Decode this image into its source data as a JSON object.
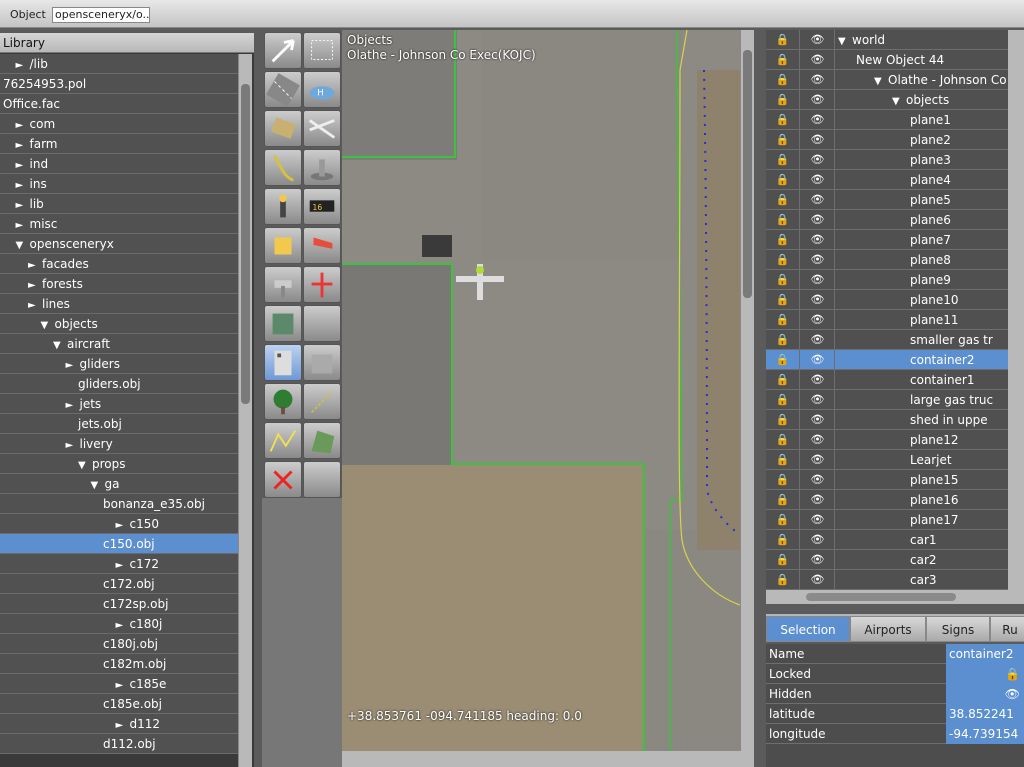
{
  "topbar": {
    "label": "Object",
    "field_value": "opensceneryx/o..."
  },
  "library": {
    "header": "Library",
    "rows": [
      {
        "text": "/lib",
        "tri": "►",
        "indent": 1
      },
      {
        "text": "76254953.pol",
        "tri": "",
        "indent": 0
      },
      {
        "text": "Office.fac",
        "tri": "",
        "indent": 0
      },
      {
        "text": "com",
        "tri": "►",
        "indent": 1
      },
      {
        "text": "farm",
        "tri": "►",
        "indent": 1
      },
      {
        "text": "ind",
        "tri": "►",
        "indent": 1
      },
      {
        "text": "ins",
        "tri": "►",
        "indent": 1
      },
      {
        "text": "lib",
        "tri": "►",
        "indent": 1
      },
      {
        "text": "misc",
        "tri": "►",
        "indent": 1
      },
      {
        "text": "opensceneryx",
        "tri": "▼",
        "indent": 1
      },
      {
        "text": "facades",
        "tri": "►",
        "indent": 2
      },
      {
        "text": "forests",
        "tri": "►",
        "indent": 2
      },
      {
        "text": "lines",
        "tri": "►",
        "indent": 2
      },
      {
        "text": "objects",
        "tri": "▼",
        "indent": 3
      },
      {
        "text": "aircraft",
        "tri": "▼",
        "indent": 4
      },
      {
        "text": "gliders",
        "tri": "►",
        "indent": 5
      },
      {
        "text": "gliders.obj",
        "tri": "",
        "indent": 6
      },
      {
        "text": "jets",
        "tri": "►",
        "indent": 5
      },
      {
        "text": "jets.obj",
        "tri": "",
        "indent": 6
      },
      {
        "text": "livery",
        "tri": "►",
        "indent": 5
      },
      {
        "text": "props",
        "tri": "▼",
        "indent": 6
      },
      {
        "text": "ga",
        "tri": "▼",
        "indent": 7
      },
      {
        "text": "bonanza_e35.obj",
        "tri": "",
        "indent": 8
      },
      {
        "text": "c150",
        "tri": "►",
        "indent": 9
      },
      {
        "text": "c150.obj",
        "tri": "",
        "indent": 8
      },
      {
        "text": "c172",
        "tri": "►",
        "indent": 9
      },
      {
        "text": "c172.obj",
        "tri": "",
        "indent": 8
      },
      {
        "text": "c172sp.obj",
        "tri": "",
        "indent": 8
      },
      {
        "text": "c180j",
        "tri": "►",
        "indent": 9
      },
      {
        "text": "c180j.obj",
        "tri": "",
        "indent": 8
      },
      {
        "text": "c182m.obj",
        "tri": "",
        "indent": 8
      },
      {
        "text": "c185e",
        "tri": "►",
        "indent": 9
      },
      {
        "text": "c185e.obj",
        "tri": "",
        "indent": 8
      },
      {
        "text": "d112",
        "tri": "►",
        "indent": 9
      },
      {
        "text": "d112.obj",
        "tri": "",
        "indent": 8
      }
    ],
    "selected_index": 24
  },
  "map": {
    "title_line1": "Objects",
    "title_line2": "Olathe - Johnson Co Exec(KOJC)",
    "coords": "+38.853761 -094.741185 heading: 0.0"
  },
  "hierarchy": {
    "rows": [
      {
        "text": "world",
        "tri": "▼",
        "indent": 1
      },
      {
        "text": "New Object 44",
        "tri": "",
        "indent": 2
      },
      {
        "text": "Olathe - Johnson Co",
        "tri": "▼",
        "indent": 3
      },
      {
        "text": "objects",
        "tri": "▼",
        "indent": 4
      },
      {
        "text": "plane1",
        "tri": "",
        "indent": 5
      },
      {
        "text": "plane2",
        "tri": "",
        "indent": 5
      },
      {
        "text": "plane3",
        "tri": "",
        "indent": 5
      },
      {
        "text": "plane4",
        "tri": "",
        "indent": 5
      },
      {
        "text": "plane5",
        "tri": "",
        "indent": 5
      },
      {
        "text": "plane6",
        "tri": "",
        "indent": 5
      },
      {
        "text": "plane7",
        "tri": "",
        "indent": 5
      },
      {
        "text": "plane8",
        "tri": "",
        "indent": 5
      },
      {
        "text": "plane9",
        "tri": "",
        "indent": 5
      },
      {
        "text": "plane10",
        "tri": "",
        "indent": 5
      },
      {
        "text": "plane11",
        "tri": "",
        "indent": 5
      },
      {
        "text": "smaller gas tr",
        "tri": "",
        "indent": 5
      },
      {
        "text": "container2",
        "tri": "",
        "indent": 5
      },
      {
        "text": "container1",
        "tri": "",
        "indent": 5
      },
      {
        "text": "large gas truc",
        "tri": "",
        "indent": 5
      },
      {
        "text": "shed in uppe",
        "tri": "",
        "indent": 5
      },
      {
        "text": "plane12",
        "tri": "",
        "indent": 5
      },
      {
        "text": "Learjet",
        "tri": "",
        "indent": 5
      },
      {
        "text": "plane15",
        "tri": "",
        "indent": 5
      },
      {
        "text": "plane16",
        "tri": "",
        "indent": 5
      },
      {
        "text": "plane17",
        "tri": "",
        "indent": 5
      },
      {
        "text": "car1",
        "tri": "",
        "indent": 5
      },
      {
        "text": "car2",
        "tri": "",
        "indent": 5
      },
      {
        "text": "car3",
        "tri": "",
        "indent": 5
      }
    ],
    "selected_index": 16
  },
  "tabs": [
    "Selection",
    "Airports",
    "Signs",
    "Ru"
  ],
  "properties": [
    {
      "key": "Name",
      "value": "container2"
    },
    {
      "key": "Locked",
      "value": ""
    },
    {
      "key": "Hidden",
      "value": ""
    },
    {
      "key": "latitude",
      "value": "38.852241"
    },
    {
      "key": "longitude",
      "value": "-94.739154"
    }
  ],
  "tools": [
    "pointer-arrow-icon",
    "marquee-select-icon",
    "runway-icon",
    "helipad-icon",
    "taxiway-icon",
    "boundary-icon",
    "taxiline-icon",
    "tower-icon",
    "beacon-icon",
    "sign-icon",
    "ramp-start-icon",
    "windsock-icon",
    "light-fixture-icon",
    "plane-object-icon",
    "facade-icon",
    "blank-tool-icon",
    "building-icon",
    "building-gray-icon",
    "tree-icon",
    "line-icon",
    "polyline-icon",
    "polygon-icon",
    "delete-icon",
    "blank-tool-icon"
  ]
}
